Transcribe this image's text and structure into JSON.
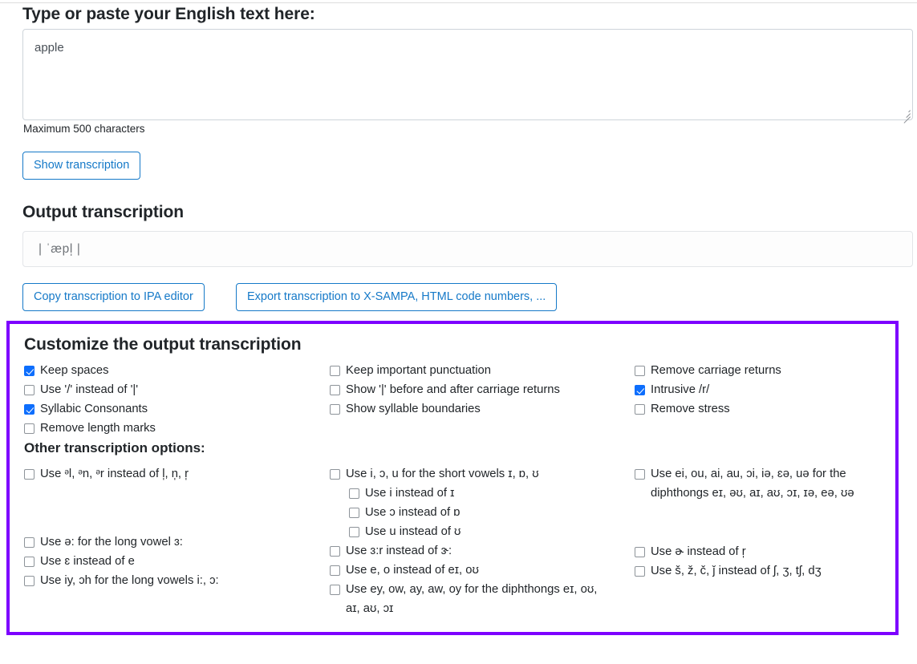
{
  "input": {
    "heading": "Type or paste your English text here:",
    "value": "apple",
    "placeholder": "",
    "hint": "Maximum 500 characters",
    "show_button": "Show transcription"
  },
  "output": {
    "heading": "Output transcription",
    "value": "| ˈæpl̩ |",
    "copy_button": "Copy transcription to IPA editor",
    "export_button": "Export transcription to X-SAMPA, HTML code numbers, ..."
  },
  "customize": {
    "heading": "Customize the output transcription",
    "border_color": "#7d00ff",
    "columns": [
      [
        {
          "label": "Keep spaces",
          "checked": true
        },
        {
          "label": "Use '/' instead of '|'",
          "checked": false
        },
        {
          "label": "Syllabic Consonants",
          "checked": true
        },
        {
          "label": "Remove length marks",
          "checked": false
        }
      ],
      [
        {
          "label": "Keep important punctuation",
          "checked": false
        },
        {
          "label": "Show '|' before and after carriage returns",
          "checked": false
        },
        {
          "label": "Show syllable boundaries",
          "checked": false
        }
      ],
      [
        {
          "label": "Remove carriage returns",
          "checked": false
        },
        {
          "label": "Intrusive /r/",
          "checked": true
        },
        {
          "label": "Remove stress",
          "checked": false
        }
      ]
    ]
  },
  "other": {
    "heading": "Other transcription options:",
    "col_a": [
      {
        "label": "Use ᵊl, ᵊn, ᵊr instead of l̩, n̩, r̩",
        "checked": false,
        "sub": false
      },
      {
        "label": "Use ə: for the long vowel ɜ:",
        "checked": false,
        "sub": false
      },
      {
        "label": "Use ɛ instead of e",
        "checked": false,
        "sub": false
      },
      {
        "label": "Use iy, ɔh for the long vowels i:, ɔ:",
        "checked": false,
        "sub": false
      }
    ],
    "col_b": [
      {
        "label": "Use i, ɔ, u for the short vowels ɪ, ɒ, ʊ",
        "checked": false,
        "sub": false
      },
      {
        "label": "Use i instead of ɪ",
        "checked": false,
        "sub": true
      },
      {
        "label": "Use ɔ instead of ɒ",
        "checked": false,
        "sub": true
      },
      {
        "label": "Use u instead of ʊ",
        "checked": false,
        "sub": true
      },
      {
        "label": "Use ɜ:r instead of ɝ:",
        "checked": false,
        "sub": false
      },
      {
        "label": "Use e, o instead of eɪ, oʊ",
        "checked": false,
        "sub": false
      },
      {
        "label": "Use ey, ow, ay, aw, oy for the diphthongs eɪ, oʊ, aɪ, aʊ, ɔɪ",
        "checked": false,
        "sub": false
      }
    ],
    "col_c": [
      {
        "label": "Use ei, ou, ai, au, ɔi, iə, ɛə, uə for the diphthongs eɪ, əʊ, aɪ, aʊ, ɔɪ, ɪə, eə, ʊə",
        "checked": false,
        "sub": false
      },
      {
        "label": "Use ɚ instead of r̩",
        "checked": false,
        "sub": false
      },
      {
        "label": "Use š, ž, č, ǰ instead of ʃ, ʒ, tʃ, dʒ",
        "checked": false,
        "sub": false
      }
    ]
  }
}
